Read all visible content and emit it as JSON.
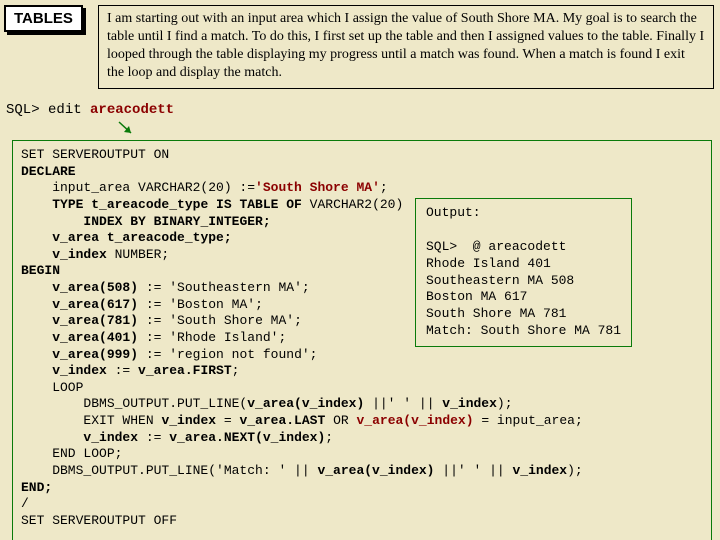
{
  "badge": "TABLES",
  "intro": "I am starting out with an input area which I assign the value of South Shore MA.  My goal is to search the table until I find a match.  To do this, I first set up the table and then I assigned values to the table.  Finally I looped through the table displaying my progress until a match was found.  When a match is found I exit the loop and display the match.",
  "prompt": {
    "sql": "SQL>",
    "cmd": "edit",
    "file": "areacodett"
  },
  "code": {
    "l01": "SET SERVEROUTPUT ON",
    "l02": "DECLARE",
    "l03_a": "    input_area VARCHAR2(20) :=",
    "l03_b": "'South Shore MA'",
    "l03_c": ";",
    "l04_a": "    ",
    "l04_b": "TYPE t_areacode_type IS TABLE OF",
    "l04_c": " VARCHAR2(20)",
    "l05_a": "        ",
    "l05_b": "INDEX BY BINARY_INTEGER;",
    "l06_a": "    ",
    "l06_b": "v_area t_areacode_type;",
    "l07_a": "    ",
    "l07_b": "v_index",
    "l07_c": " NUMBER;",
    "l08": "BEGIN",
    "l09_a": "    ",
    "l09_b": "v_area(508)",
    "l09_c": " := 'Southeastern MA';",
    "l10_a": "    ",
    "l10_b": "v_area(617)",
    "l10_c": " := 'Boston MA';",
    "l11_a": "    ",
    "l11_b": "v_area(781)",
    "l11_c": " := 'South Shore MA';",
    "l12_a": "    ",
    "l12_b": "v_area(401)",
    "l12_c": " := 'Rhode Island';",
    "l13_a": "    ",
    "l13_b": "v_area(999)",
    "l13_c": " := 'region not found';",
    "l14_a": "    ",
    "l14_b": "v_index",
    "l14_c": " := ",
    "l14_d": "v_area.FIRST",
    "l14_e": ";",
    "l15": "    LOOP",
    "l16_a": "        DBMS_OUTPUT.PUT_LINE(",
    "l16_b": "v_area(v_index)",
    "l16_c": " ||' ' || ",
    "l16_d": "v_index",
    "l16_e": ");",
    "l17_a": "        EXIT WHEN ",
    "l17_b": "v_index",
    "l17_c": " = ",
    "l17_d": "v_area.LAST",
    "l17_e": " OR ",
    "l17_f": "v_area(v_index)",
    "l17_g": " = input_area;",
    "l18_a": "        ",
    "l18_b": "v_index",
    "l18_c": " := ",
    "l18_d": "v_area.NEXT(v_index)",
    "l18_e": ";",
    "l19": "    END LOOP;",
    "l20_a": "    DBMS_OUTPUT.PUT_LINE('Match: ' || ",
    "l20_b": "v_area(v_index)",
    "l20_c": " ||' ' || ",
    "l20_d": "v_index",
    "l20_e": ");",
    "l21": "END;",
    "l22": "/",
    "l23": "SET SERVEROUTPUT OFF"
  },
  "output": {
    "l1": "Output:",
    "l2": "",
    "l3": "SQL>  @ areacodett",
    "l4": "Rhode Island 401",
    "l5": "Southeastern MA 508",
    "l6": "Boston MA 617",
    "l7": "South Shore MA 781",
    "l8": "Match: South Shore MA 781"
  }
}
